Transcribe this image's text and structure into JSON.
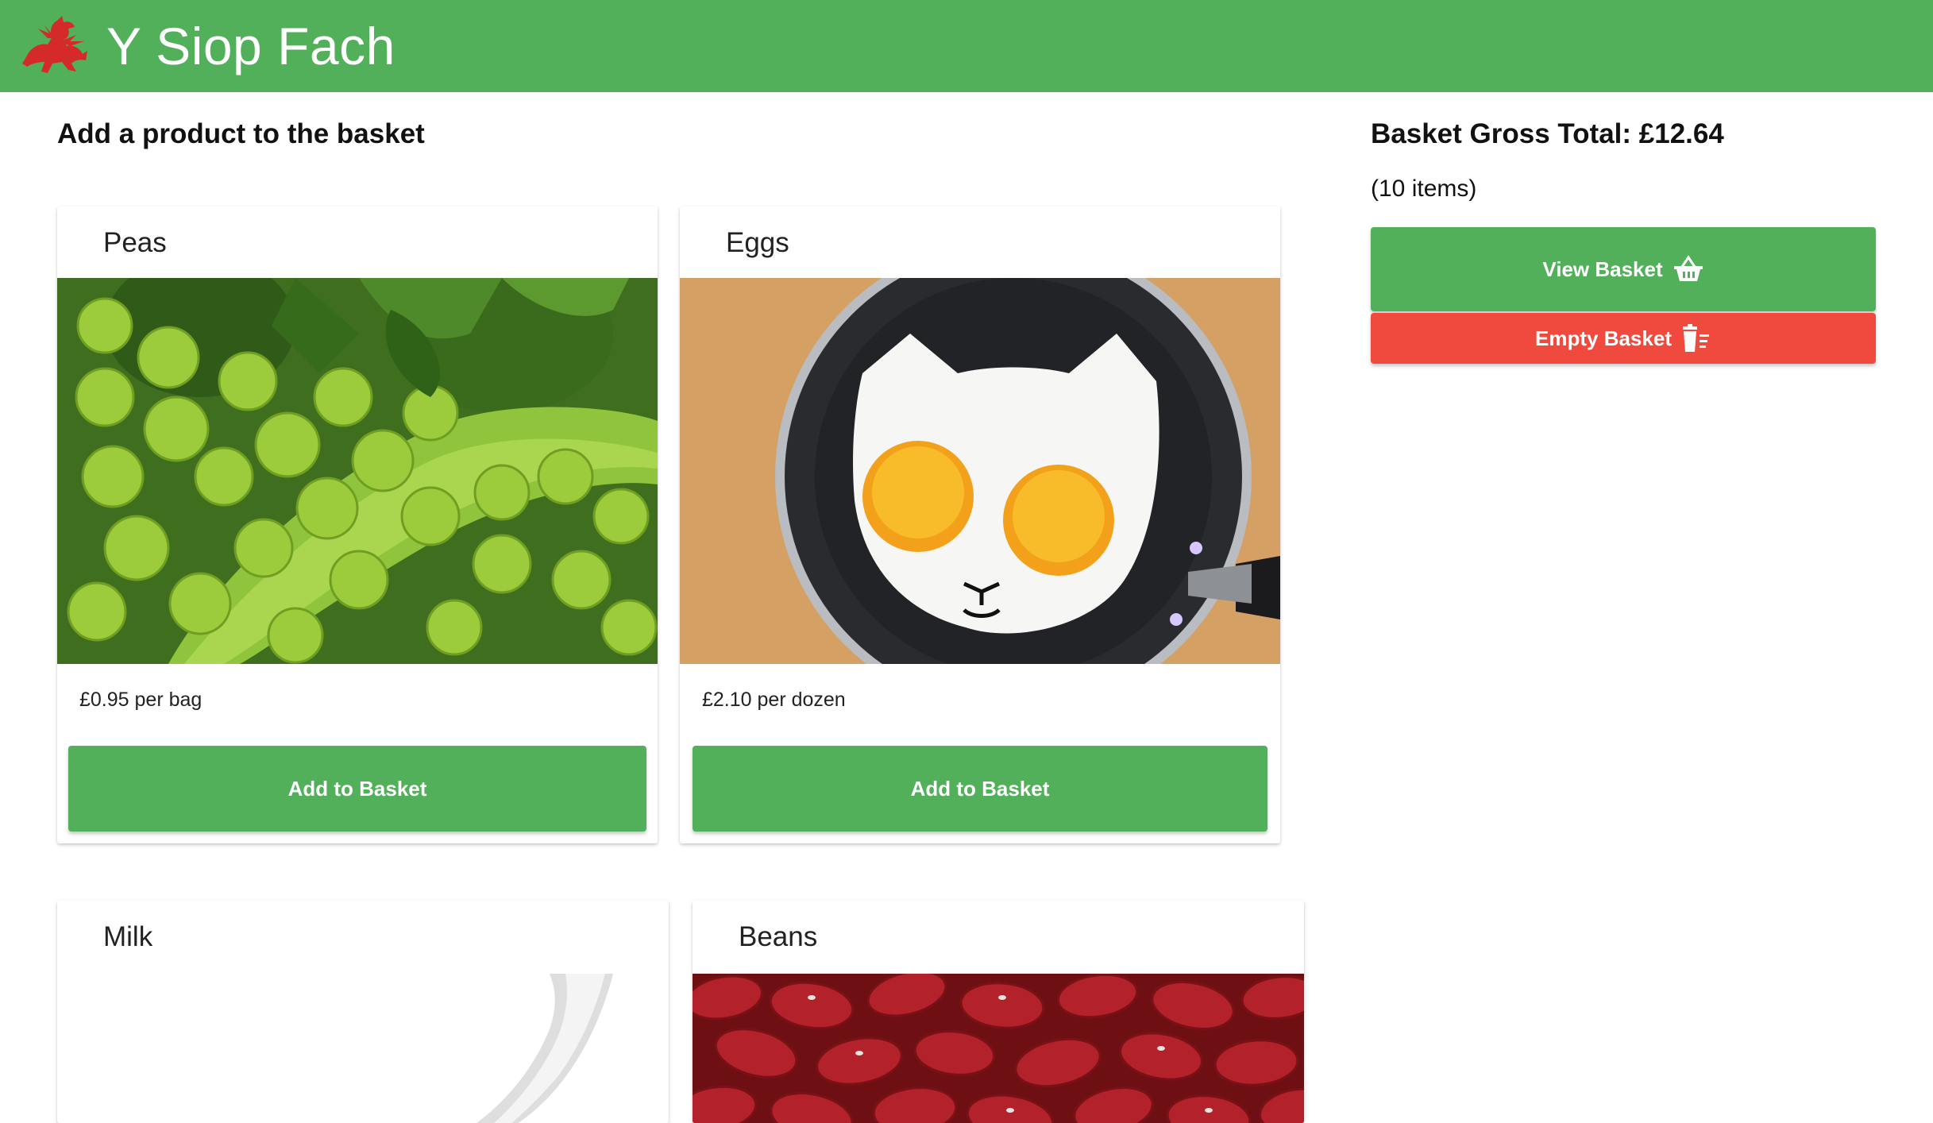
{
  "header": {
    "title": "Y Siop Fach",
    "logo_icon": "welsh-dragon-icon",
    "background_color": "#52b05a"
  },
  "main": {
    "heading": "Add a product to the basket",
    "products": [
      {
        "name": "Peas",
        "price": "£0.95 per bag",
        "button_label": "Add to Basket",
        "image": "peas-photo"
      },
      {
        "name": "Eggs",
        "price": "£2.10 per dozen",
        "button_label": "Add to Basket",
        "image": "cat-shaped-fried-eggs-photo"
      },
      {
        "name": "Milk",
        "image": "milk-splash-photo"
      },
      {
        "name": "Beans",
        "image": "kidney-beans-photo"
      }
    ]
  },
  "basket": {
    "total": "Basket Gross Total: £12.64",
    "count": "(10 items)",
    "view_label": "View Basket",
    "view_icon": "shopping-basket-icon",
    "empty_label": "Empty Basket",
    "empty_icon": "trash-list-icon",
    "accent_color": "#52b05a",
    "danger_color": "#f04a3e"
  }
}
